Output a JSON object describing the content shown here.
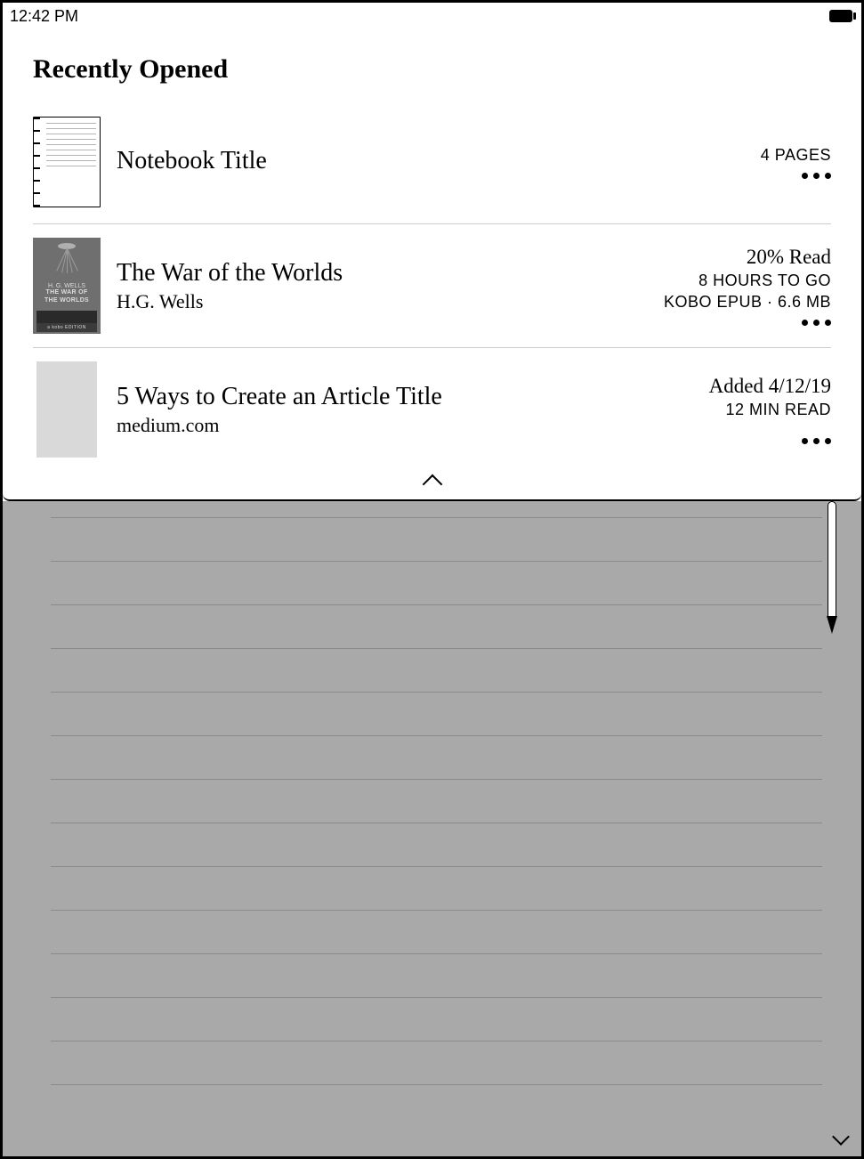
{
  "statusbar": {
    "time": "12:42 PM"
  },
  "header": {
    "title": "Recently Opened"
  },
  "items": [
    {
      "kind": "notebook",
      "title": "Notebook Title",
      "subtitle": "",
      "meta1": "",
      "meta2": "4 PAGES",
      "meta3": ""
    },
    {
      "kind": "book",
      "title": "The War of the Worlds",
      "subtitle": "H.G. Wells",
      "meta1": "20% Read",
      "meta2": "8 HOURS TO GO",
      "meta3": "KOBO EPUB · 6.6 MB",
      "cover": {
        "author": "H. G. WELLS",
        "line1": "THE WAR OF",
        "line2": "THE WORLDS",
        "edition": "a kobo EDITION"
      }
    },
    {
      "kind": "article",
      "title": "5 Ways to Create an Article Title",
      "subtitle": "medium.com",
      "meta1": "Added 4/12/19",
      "meta2": "12 MIN READ",
      "meta3": ""
    }
  ]
}
